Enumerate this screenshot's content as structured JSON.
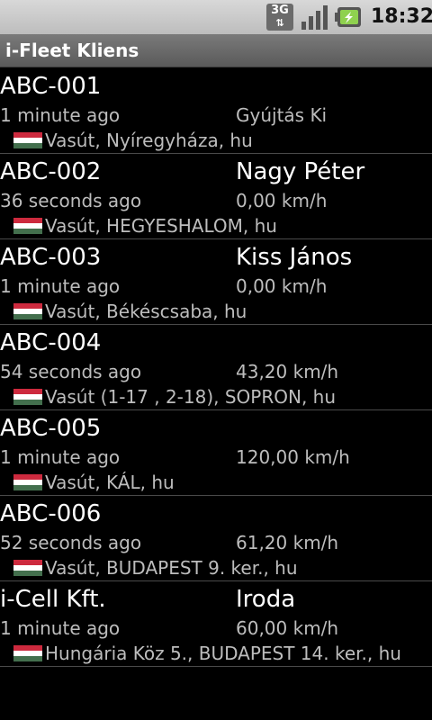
{
  "statusbar": {
    "network": "3G",
    "clock": "18:32",
    "icons": [
      "network-3g-icon",
      "signal-icon",
      "battery-charging-icon"
    ]
  },
  "app": {
    "title": "i-Fleet Kliens"
  },
  "colors": {
    "flag_red": "#cd2a3e",
    "flag_white": "#ffffff",
    "flag_green": "#436f4d"
  },
  "vehicles": [
    {
      "name": "ABC-001",
      "driver": "",
      "time": "1 minute ago",
      "status": "Gyújtás Ki",
      "address": "Vasút, Nyíregyháza, hu"
    },
    {
      "name": "ABC-002",
      "driver": "Nagy Péter",
      "time": "36 seconds ago",
      "status": "0,00 km/h",
      "address": "Vasút, HEGYESHALOM, hu"
    },
    {
      "name": "ABC-003",
      "driver": "Kiss János",
      "time": "1 minute ago",
      "status": "0,00 km/h",
      "address": "Vasút, Békéscsaba, hu"
    },
    {
      "name": "ABC-004",
      "driver": "",
      "time": "54 seconds ago",
      "status": "43,20 km/h",
      "address": "Vasút (1-17 , 2-18), SOPRON, hu"
    },
    {
      "name": "ABC-005",
      "driver": "",
      "time": "1 minute ago",
      "status": "120,00 km/h",
      "address": "Vasút, KÁL, hu"
    },
    {
      "name": "ABC-006",
      "driver": "",
      "time": "52 seconds ago",
      "status": "61,20 km/h",
      "address": "Vasút, BUDAPEST 9. ker., hu"
    },
    {
      "name": "i-Cell Kft.",
      "driver": "Iroda",
      "time": "1 minute ago",
      "status": "60,00 km/h",
      "address": "Hungária Köz 5., BUDAPEST 14. ker., hu"
    }
  ]
}
